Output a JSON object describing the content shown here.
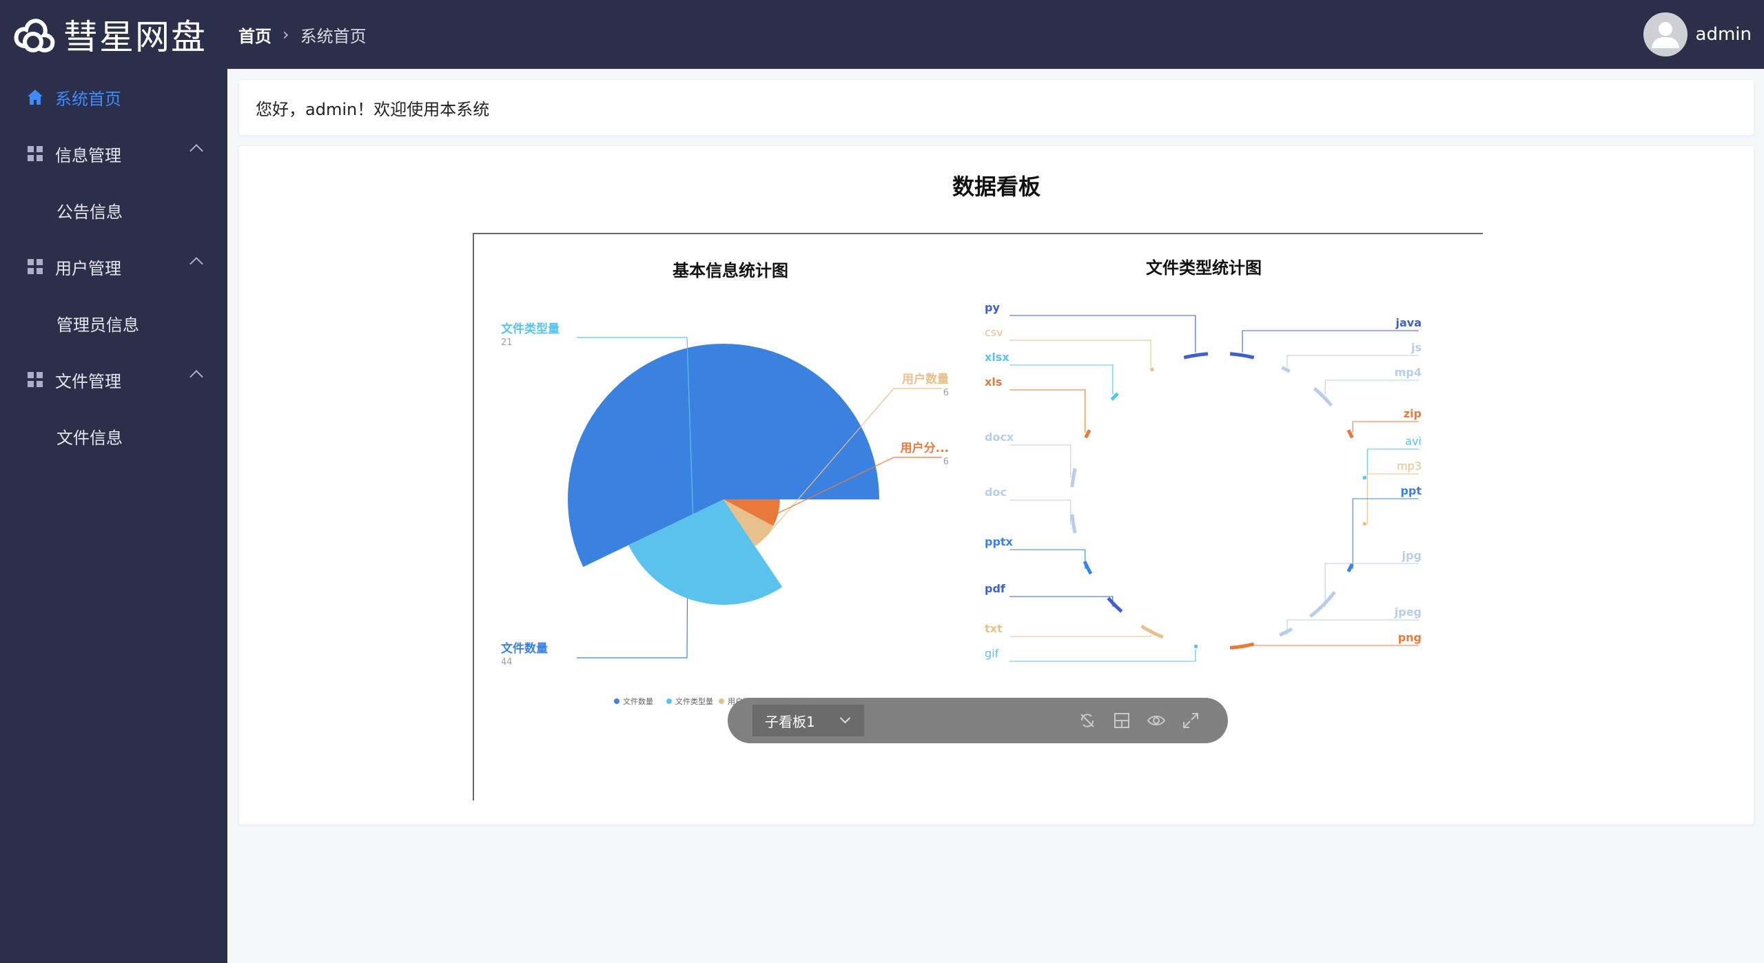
{
  "app": {
    "name": "彗星网盘"
  },
  "breadcrumb": {
    "home": "首页",
    "current": "系统首页"
  },
  "user": {
    "name": "admin"
  },
  "sidebar": {
    "items": [
      {
        "label": "系统首页",
        "icon": "home-icon",
        "active": true
      },
      {
        "label": "信息管理",
        "icon": "grid-icon",
        "children": [
          {
            "label": "公告信息"
          }
        ]
      },
      {
        "label": "用户管理",
        "icon": "grid-icon",
        "children": [
          {
            "label": "管理员信息"
          }
        ]
      },
      {
        "label": "文件管理",
        "icon": "grid-icon",
        "children": [
          {
            "label": "文件信息"
          }
        ]
      }
    ]
  },
  "welcome": {
    "text": "您好，admin！欢迎使用本系统"
  },
  "dashboard": {
    "title": "数据看板"
  },
  "toolbar": {
    "panel_select": "子看板1",
    "icons": [
      "no-sync-icon",
      "layout-icon",
      "eye-icon",
      "fullscreen-icon"
    ]
  },
  "colors": {
    "nav_bg": "#2b2f4a",
    "accent": "#3d8bff",
    "blue": "#3b82e0",
    "light_blue": "#5bc2ee",
    "tan": "#e8c08c",
    "orange": "#e8793a",
    "pale_blue": "#b9cdea",
    "dark_blue": "#3d5fd0"
  },
  "chart_data": [
    {
      "type": "pie",
      "title": "基本信息统计图",
      "rose": true,
      "slices": [
        {
          "label": "文件数量",
          "value": 44,
          "color": "#3b82e0"
        },
        {
          "label": "文件类型量",
          "value": 21,
          "color": "#5bc2ee"
        },
        {
          "label": "用户数量",
          "value": 6,
          "color": "#e8c08c"
        },
        {
          "label": "用户分...",
          "value": 6,
          "color": "#e8793a"
        }
      ],
      "legend": {
        "position": "bottom",
        "items": [
          "文件数量",
          "文件类型量",
          "用户数量",
          "用户分类数量"
        ]
      }
    },
    {
      "type": "pie",
      "title": "文件类型统计图",
      "subtype": "ring",
      "categories": [
        {
          "label": "java",
          "value": 4,
          "color": "#3d5fd0"
        },
        {
          "label": "js",
          "value": 1,
          "color": "#b9cdea"
        },
        {
          "label": "mp4",
          "value": 4,
          "color": "#b9cdea"
        },
        {
          "label": "zip",
          "value": 1,
          "color": "#e8793a"
        },
        {
          "label": "avi",
          "value": 0,
          "color": "#5bc2ee"
        },
        {
          "label": "mp3",
          "value": 0,
          "color": "#e8c08c"
        },
        {
          "label": "ppt",
          "value": 1,
          "color": "#3b82e0"
        },
        {
          "label": "jpg",
          "value": 6,
          "color": "#b9cdea"
        },
        {
          "label": "jpeg",
          "value": 2,
          "color": "#b9cdea"
        },
        {
          "label": "png",
          "value": 4,
          "color": "#e8793a"
        },
        {
          "label": "gif",
          "value": 0,
          "color": "#5bc2ee"
        },
        {
          "label": "txt",
          "value": 4,
          "color": "#e8c08c"
        },
        {
          "label": "pdf",
          "value": 3,
          "color": "#3d5fd0"
        },
        {
          "label": "pptx",
          "value": 2,
          "color": "#3b82e0"
        },
        {
          "label": "doc",
          "value": 3,
          "color": "#b9cdea"
        },
        {
          "label": "docx",
          "value": 3,
          "color": "#b9cdea"
        },
        {
          "label": "xls",
          "value": 1,
          "color": "#e8793a"
        },
        {
          "label": "xlsx",
          "value": 1,
          "color": "#5bc2ee"
        },
        {
          "label": "csv",
          "value": 0,
          "color": "#e8c08c"
        },
        {
          "label": "py",
          "value": 4,
          "color": "#3d5fd0"
        }
      ]
    }
  ]
}
